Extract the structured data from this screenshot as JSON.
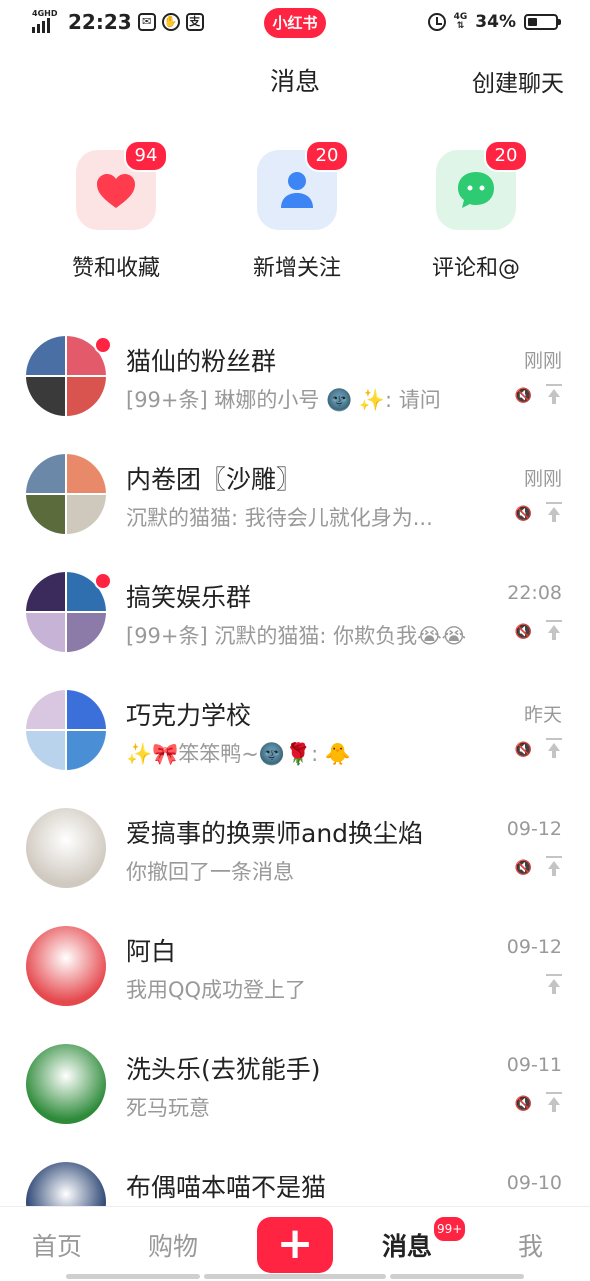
{
  "status_bar": {
    "network": "4GHD",
    "time": "22:23",
    "icons": [
      "mail-icon",
      "hand-icon",
      "alipay-icon"
    ],
    "icon_glyphs": [
      "✉",
      "✋",
      "支"
    ],
    "app_badge": "小红书",
    "data_network": "4G",
    "battery_pct": "34%",
    "battery_level": 0.34
  },
  "header": {
    "title": "消息",
    "create_chat": "创建聊天"
  },
  "categories": [
    {
      "label": "赞和收藏",
      "badge": "94",
      "icon": "heart-icon",
      "bg": "#fde4e4",
      "color": "#ff3b4e"
    },
    {
      "label": "新增关注",
      "badge": "20",
      "icon": "person-icon",
      "bg": "#e2ecfb",
      "color": "#3d85f5"
    },
    {
      "label": "评论和@",
      "badge": "20",
      "icon": "chat-bubble-icon",
      "bg": "#dff5e8",
      "color": "#2ecb72"
    }
  ],
  "chats": [
    {
      "name": "猫仙的粉丝群",
      "time": "刚刚",
      "preview": "[99+条] 琳娜的小号 🌚 ✨: 请问",
      "unread": true,
      "muted": true,
      "pinned": true,
      "avatar_colors": [
        "#4a6fa5",
        "#e35b6b",
        "#3a3a3a",
        "#d9534f"
      ]
    },
    {
      "name": "内卷团〖沙雕〗",
      "time": "刚刚",
      "preview": "沉默的猫猫: 我待会儿就化身为...",
      "unread": false,
      "muted": true,
      "pinned": true,
      "avatar_colors": [
        "#6b88a8",
        "#e88a6a",
        "#5c6b3c",
        "#cfc8bd"
      ]
    },
    {
      "name": "搞笑娱乐群",
      "time": "22:08",
      "preview": "[99+条] 沉默的猫猫: 你欺负我😭😭",
      "unread": true,
      "muted": true,
      "pinned": true,
      "avatar_colors": [
        "#3b2a5c",
        "#2f6fb0",
        "#c7b3d6",
        "#8c7aa8"
      ]
    },
    {
      "name": "巧克力学校",
      "time": "昨天",
      "preview": "✨🎀笨笨鸭~🌚🌹: 🐥",
      "unread": false,
      "muted": true,
      "pinned": true,
      "avatar_colors": [
        "#d9c6e0",
        "#3b6fd9",
        "#b9d3ec",
        "#4a8fd6"
      ]
    },
    {
      "name": "爱搞事的换票师and换尘焰",
      "time": "09-12",
      "preview": "你撤回了一条消息",
      "unread": false,
      "muted": true,
      "pinned": true,
      "avatar_colors": [
        "#cfc9bf"
      ]
    },
    {
      "name": "阿白",
      "time": "09-12",
      "preview": "我用QQ成功登上了",
      "unread": false,
      "muted": false,
      "pinned": true,
      "avatar_colors": [
        "#e5484d"
      ]
    },
    {
      "name": "洗头乐(去犹能手)",
      "time": "09-11",
      "preview": "死马玩意",
      "unread": false,
      "muted": true,
      "pinned": true,
      "avatar_colors": [
        "#2e8b3a"
      ]
    },
    {
      "name": "布偶喵本喵不是猫",
      "time": "09-10",
      "preview": "",
      "unread": false,
      "muted": false,
      "pinned": false,
      "avatar_colors": [
        "#1f3a6b"
      ]
    }
  ],
  "bottom_nav": {
    "home": "首页",
    "shop": "购物",
    "plus": "+",
    "messages": "消息",
    "messages_badge": "99+",
    "me": "我"
  },
  "colors": {
    "brand": "#ff2442",
    "muted_text": "#999999"
  }
}
